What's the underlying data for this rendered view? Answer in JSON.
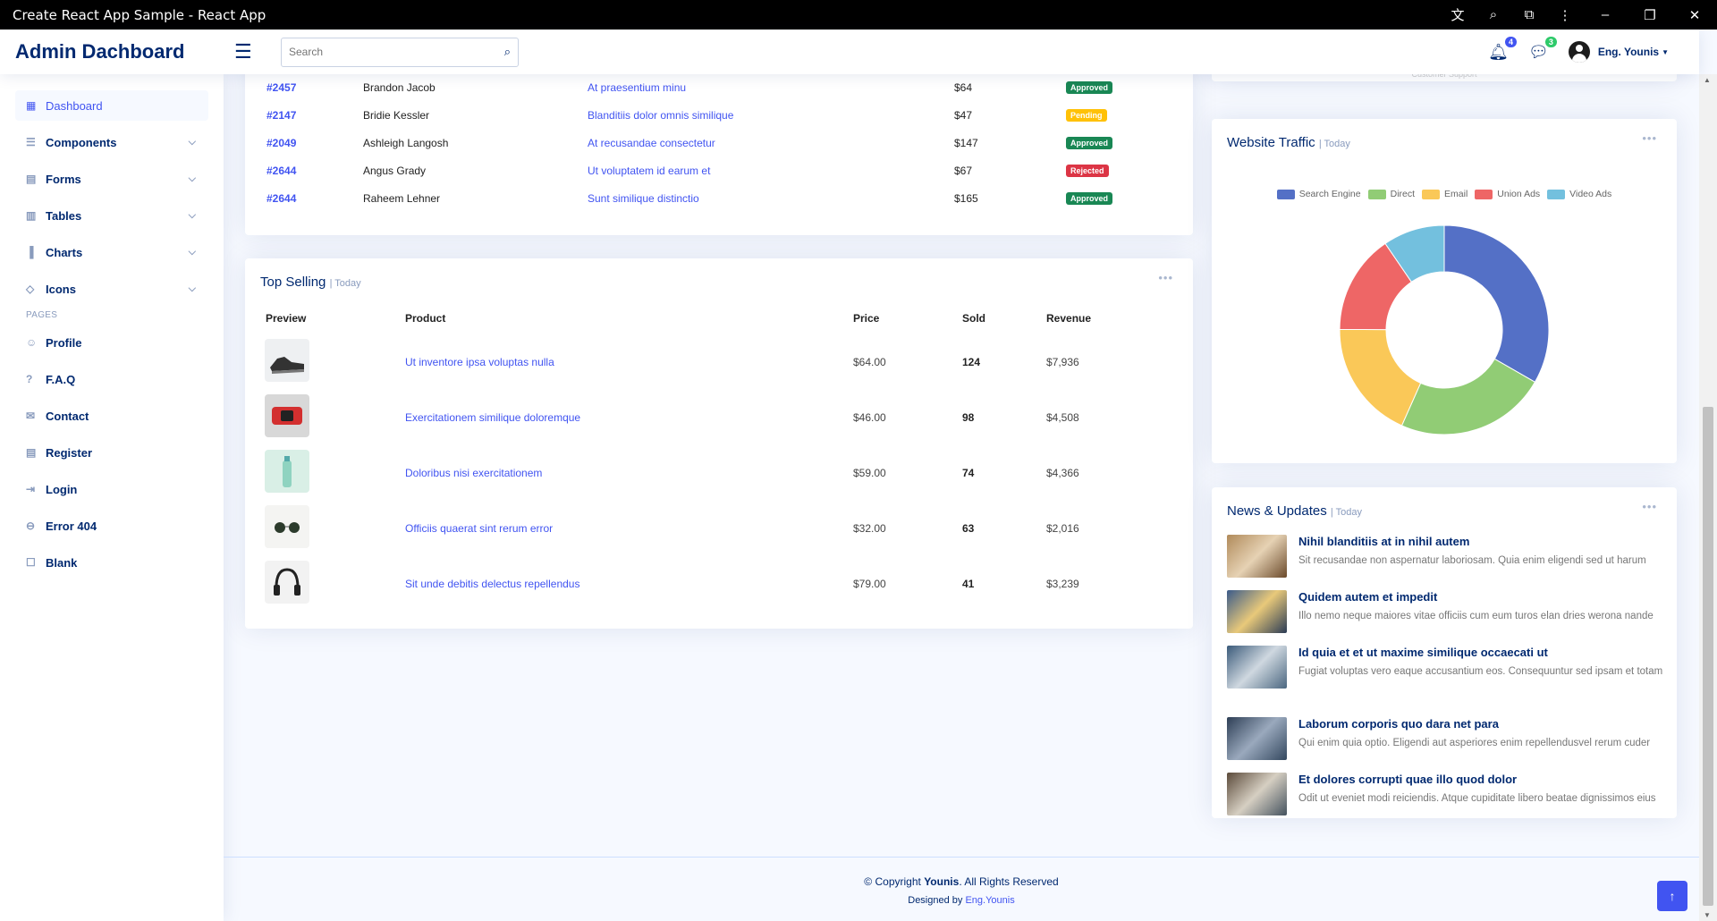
{
  "window": {
    "title": "Create React App Sample - React App"
  },
  "header": {
    "logo": "Admin Dachboard",
    "search_placeholder": "Search",
    "notifications_count": "4",
    "messages_count": "3",
    "user_name": "Eng. Younis"
  },
  "sidebar": {
    "items": [
      {
        "label": "Dashboard",
        "icon": "grid-icon"
      },
      {
        "label": "Components",
        "icon": "menu-icon"
      },
      {
        "label": "Forms",
        "icon": "journal-icon"
      },
      {
        "label": "Tables",
        "icon": "layout-icon"
      },
      {
        "label": "Charts",
        "icon": "bar-chart-icon"
      },
      {
        "label": "Icons",
        "icon": "gem-icon"
      }
    ],
    "pages_heading": "PAGES",
    "pages": [
      {
        "label": "Profile"
      },
      {
        "label": "F.A.Q"
      },
      {
        "label": "Contact"
      },
      {
        "label": "Register"
      },
      {
        "label": "Login"
      },
      {
        "label": "Error 404"
      },
      {
        "label": "Blank"
      }
    ]
  },
  "recent_sales": {
    "rows": [
      {
        "id": "#2457",
        "customer": "Brandon Jacob",
        "product": "At praesentium minu",
        "price": "$64",
        "status": "Approved"
      },
      {
        "id": "#2147",
        "customer": "Bridie Kessler",
        "product": "Blanditiis dolor omnis similique",
        "price": "$47",
        "status": "Pending"
      },
      {
        "id": "#2049",
        "customer": "Ashleigh Langosh",
        "product": "At recusandae consectetur",
        "price": "$147",
        "status": "Approved"
      },
      {
        "id": "#2644",
        "customer": "Angus Grady",
        "product": "Ut voluptatem id earum et",
        "price": "$67",
        "status": "Rejected"
      },
      {
        "id": "#2644",
        "customer": "Raheem Lehner",
        "product": "Sunt similique distinctio",
        "price": "$165",
        "status": "Approved"
      }
    ]
  },
  "top_selling": {
    "title": "Top Selling",
    "filter": "| Today",
    "headers": {
      "preview": "Preview",
      "product": "Product",
      "price": "Price",
      "sold": "Sold",
      "revenue": "Revenue"
    },
    "rows": [
      {
        "product": "Ut inventore ipsa voluptas nulla",
        "price": "$64.00",
        "sold": "124",
        "revenue": "$7,936"
      },
      {
        "product": "Exercitationem similique doloremque",
        "price": "$46.00",
        "sold": "98",
        "revenue": "$4,508"
      },
      {
        "product": "Doloribus nisi exercitationem",
        "price": "$59.00",
        "sold": "74",
        "revenue": "$4,366"
      },
      {
        "product": "Officiis quaerat sint rerum error",
        "price": "$32.00",
        "sold": "63",
        "revenue": "$2,016"
      },
      {
        "product": "Sit unde debitis delectus repellendus",
        "price": "$79.00",
        "sold": "41",
        "revenue": "$3,239"
      }
    ]
  },
  "partial_card": {
    "caption": "Customer Support"
  },
  "website_traffic": {
    "title": "Website Traffic",
    "filter": "| Today"
  },
  "chart_data": {
    "type": "pie",
    "categories": [
      "Search Engine",
      "Direct",
      "Email",
      "Union Ads",
      "Video Ads"
    ],
    "values": [
      1048,
      735,
      580,
      484,
      300
    ],
    "colors": [
      "#5470c6",
      "#91cc75",
      "#fac858",
      "#ee6666",
      "#73c0de"
    ],
    "legend_position": "top",
    "donut": true
  },
  "news": {
    "title": "News & Updates",
    "filter": "| Today",
    "items": [
      {
        "title": "Nihil blanditiis at in nihil autem",
        "text": "Sit recusandae non aspernatur laboriosam. Quia enim eligendi sed ut harum"
      },
      {
        "title": "Quidem autem et impedit",
        "text": "Illo nemo neque maiores vitae officiis cum eum turos elan dries werona nande"
      },
      {
        "title": "Id quia et et ut maxime similique occaecati ut",
        "text": "Fugiat voluptas vero eaque accusantium eos. Consequuntur sed ipsam et totam"
      },
      {
        "title": "Laborum corporis quo dara net para",
        "text": "Qui enim quia optio. Eligendi aut asperiores enim repellendusvel rerum cuder"
      },
      {
        "title": "Et dolores corrupti quae illo quod dolor",
        "text": "Odit ut eveniet modi reiciendis. Atque cupiditate libero beatae dignissimos eius"
      }
    ]
  },
  "footer": {
    "copyright_prefix": "© Copyright",
    "copyright_name": "Younis",
    "copyright_suffix": ". All Rights Reserved",
    "designed_prefix": "Designed by",
    "designed_name": "Eng.Younis"
  }
}
